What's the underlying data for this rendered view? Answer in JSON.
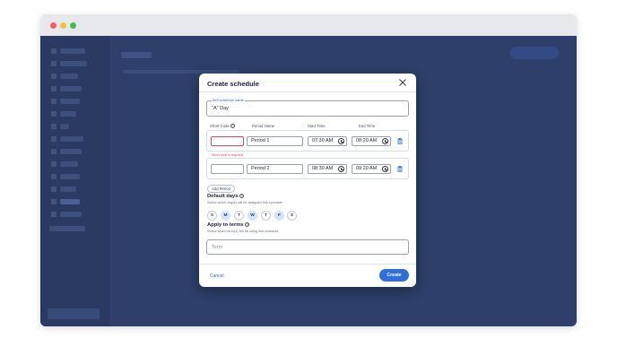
{
  "modal": {
    "title": "Create schedule",
    "bell_schedule": {
      "label": "Bell schedule name",
      "value": "\"A\" Day"
    },
    "columns": {
      "short_code": "Short Code",
      "period_name": "Period Name",
      "start_time": "Start Time",
      "end_time": "End Time"
    },
    "periods": [
      {
        "short_code": "",
        "name": "Period 1",
        "start": "07:30 AM",
        "end": "08:20 AM",
        "error": "Short code is required"
      },
      {
        "short_code": "",
        "name": "Period 2",
        "start": "08:30 AM",
        "end": "09:20 AM",
        "error": ""
      }
    ],
    "add_period_label": "Add Period",
    "default_days": {
      "title": "Default days",
      "subtitle": "Select which day(s) will be assigned this schedule",
      "days": [
        {
          "label": "S",
          "selected": false
        },
        {
          "label": "M",
          "selected": true
        },
        {
          "label": "T",
          "selected": false
        },
        {
          "label": "W",
          "selected": true
        },
        {
          "label": "T",
          "selected": false
        },
        {
          "label": "F",
          "selected": true
        },
        {
          "label": "S",
          "selected": false
        }
      ]
    },
    "apply_terms": {
      "title": "Apply to terms",
      "subtitle": "Select which term(s) will be using this schedule",
      "placeholder": "Term"
    },
    "cancel_label": "Cancel",
    "create_label": "Create"
  },
  "colors": {
    "accent": "#2f6fd9",
    "error": "#e0465a",
    "overlay": "#2d3f6a",
    "day_selected": "#d6e3f8"
  },
  "icons": [
    "close-icon",
    "help-icon",
    "clock-icon",
    "trash-icon"
  ]
}
